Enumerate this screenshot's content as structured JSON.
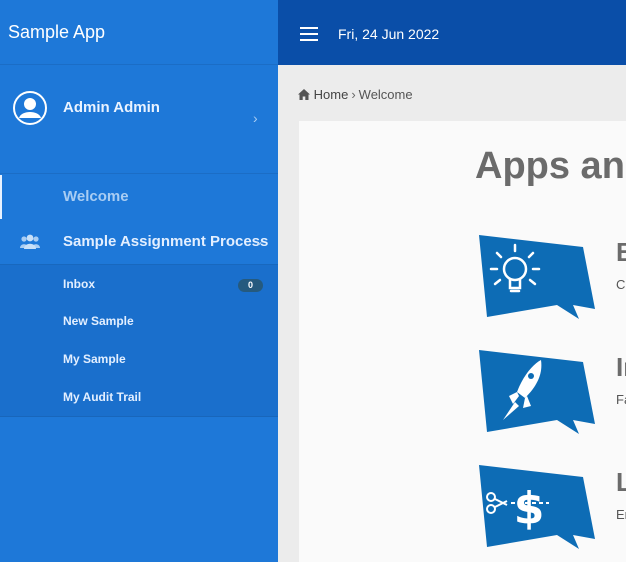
{
  "app": {
    "title": "Sample App"
  },
  "user": {
    "name": "Admin Admin"
  },
  "header": {
    "date": "Fri, 24 Jun 2022"
  },
  "nav": {
    "welcome": "Welcome",
    "process": {
      "label": "Sample Assignment Process",
      "items": [
        {
          "label": "Inbox",
          "badge": "0"
        },
        {
          "label": "New Sample"
        },
        {
          "label": "My Sample"
        },
        {
          "label": "My Audit Trail"
        }
      ]
    }
  },
  "breadcrumb": {
    "home": "Home",
    "current": "Welcome"
  },
  "content": {
    "heading": "Apps and",
    "features": [
      {
        "icon": "lightbulb-icon",
        "title": "B",
        "desc": "Cr"
      },
      {
        "icon": "rocket-icon",
        "title": "In",
        "desc": "Fa"
      },
      {
        "icon": "scissors-dollar-icon",
        "title": "L",
        "desc": "Er"
      }
    ]
  },
  "colors": {
    "sidebar": "#1e78d8",
    "topbar": "#0a4ea8",
    "bubble": "#0d6cb5",
    "submenu": "#1a6fcc"
  }
}
